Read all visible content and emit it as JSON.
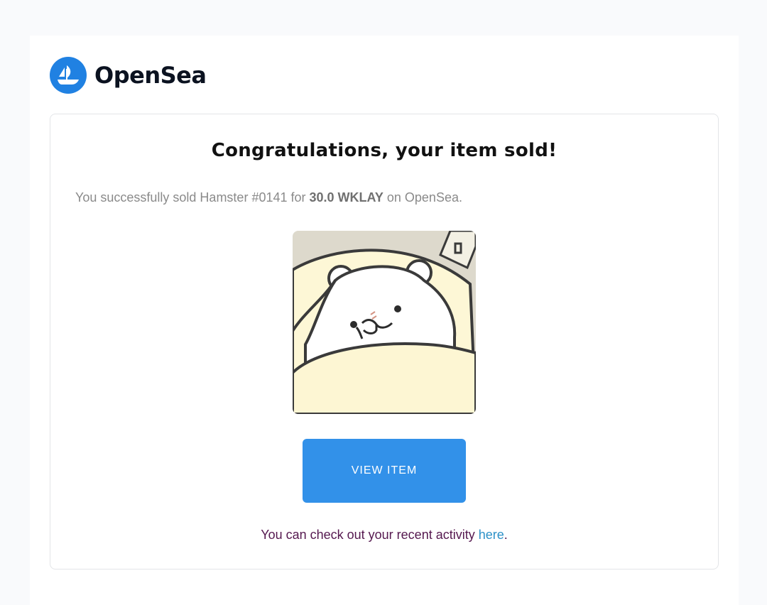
{
  "brand": {
    "name": "OpenSea",
    "logo_icon": "opensea-boat-icon",
    "color": "#2081e2"
  },
  "card": {
    "headline": "Congratulations, your item sold!",
    "message": {
      "prefix": "You successfully sold Hamster #0141 for ",
      "amount": "30.0 WKLAY",
      "suffix": " on OpenSea."
    },
    "item_image": "hamster-nft-image",
    "button_label": "VIEW ITEM",
    "button_color": "#3291e9",
    "activity": {
      "prefix": "You can check out your recent activity ",
      "link_label": "here",
      "suffix": "."
    }
  }
}
